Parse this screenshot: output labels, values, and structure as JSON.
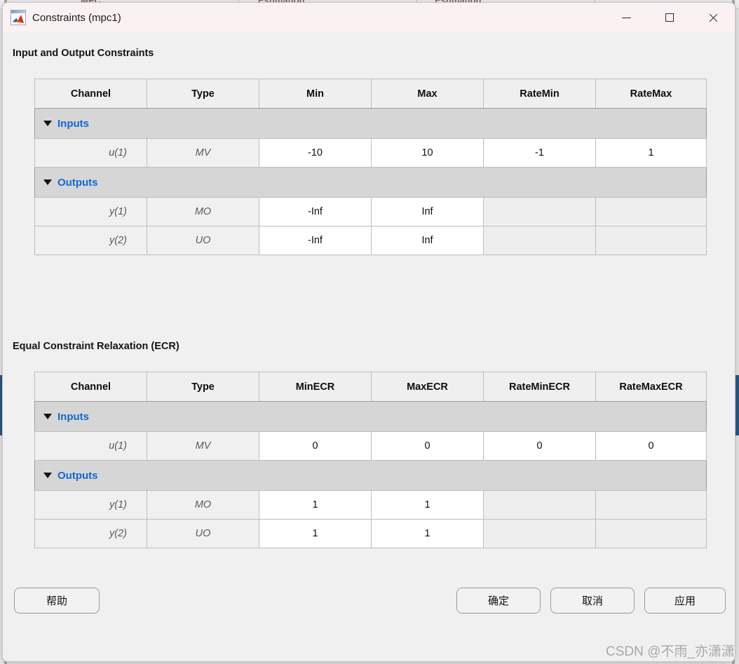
{
  "backdrop": {
    "tabs": [
      "MPC",
      "Estimation",
      "Estimation"
    ],
    "accent_color": "#2b5a87"
  },
  "window": {
    "title": "Constraints (mpc1)",
    "icon": "matlab-membrane-icon",
    "controls": {
      "minimize": "minimize-icon",
      "maximize": "maximize-icon",
      "close": "close-icon"
    }
  },
  "sections": {
    "constraints": {
      "label": "Input and Output Constraints",
      "table": {
        "headers": [
          "Channel",
          "Type",
          "Min",
          "Max",
          "RateMin",
          "RateMax"
        ],
        "groups": [
          {
            "label": "Inputs",
            "rows": [
              {
                "channel": "u(1)",
                "type": "MV",
                "values": [
                  "-10",
                  "10",
                  "-1",
                  "1"
                ],
                "editable": [
                  true,
                  true,
                  true,
                  true
                ]
              }
            ]
          },
          {
            "label": "Outputs",
            "rows": [
              {
                "channel": "y(1)",
                "type": "MO",
                "values": [
                  "-Inf",
                  "Inf",
                  "",
                  ""
                ],
                "editable": [
                  true,
                  true,
                  false,
                  false
                ]
              },
              {
                "channel": "y(2)",
                "type": "UO",
                "values": [
                  "-Inf",
                  "Inf",
                  "",
                  ""
                ],
                "editable": [
                  true,
                  true,
                  false,
                  false
                ]
              }
            ]
          }
        ]
      }
    },
    "ecr": {
      "label": "Equal Constraint Relaxation (ECR)",
      "table": {
        "headers": [
          "Channel",
          "Type",
          "MinECR",
          "MaxECR",
          "RateMinECR",
          "RateMaxECR"
        ],
        "groups": [
          {
            "label": "Inputs",
            "rows": [
              {
                "channel": "u(1)",
                "type": "MV",
                "values": [
                  "0",
                  "0",
                  "0",
                  "0"
                ],
                "editable": [
                  true,
                  true,
                  true,
                  true
                ]
              }
            ]
          },
          {
            "label": "Outputs",
            "rows": [
              {
                "channel": "y(1)",
                "type": "MO",
                "values": [
                  "1",
                  "1",
                  "",
                  ""
                ],
                "editable": [
                  true,
                  true,
                  false,
                  false
                ]
              },
              {
                "channel": "y(2)",
                "type": "UO",
                "values": [
                  "1",
                  "1",
                  "",
                  ""
                ],
                "editable": [
                  true,
                  true,
                  false,
                  false
                ]
              }
            ]
          }
        ]
      }
    }
  },
  "footer": {
    "help": "帮助",
    "ok": "确定",
    "cancel": "取消",
    "apply": "应用"
  },
  "watermark": "CSDN @不雨_亦潇潇"
}
